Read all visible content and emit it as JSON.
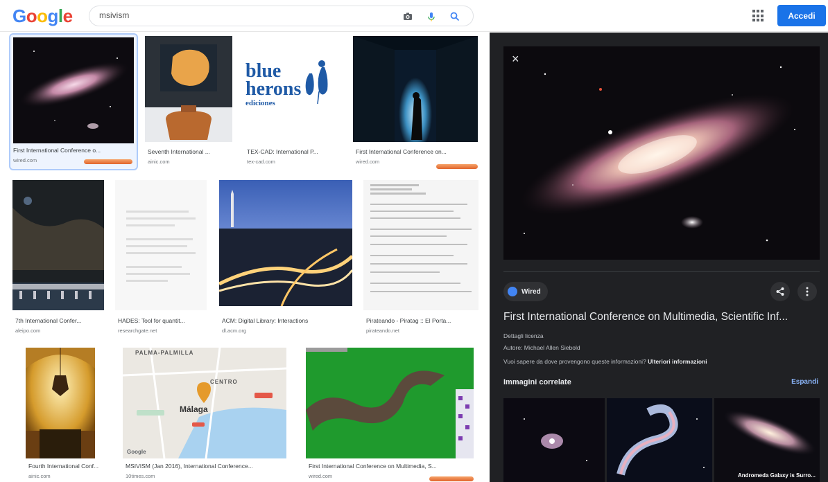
{
  "header": {
    "logo": [
      "G",
      "o",
      "o",
      "g",
      "l",
      "e"
    ],
    "search_value": "msivism",
    "login_label": "Accedi",
    "icons": [
      "camera-icon",
      "mic-icon",
      "search-icon",
      "apps-icon"
    ]
  },
  "results": [
    {
      "caption": "First International Conference o...",
      "source": "wired.com"
    },
    {
      "caption": "Seventh International ...",
      "source": "ainic.com"
    },
    {
      "caption": "TEX-CAD: International P...",
      "source": "tex-cad.com"
    },
    {
      "caption": "First International Conference on...",
      "source": "wired.com"
    },
    {
      "caption": "7th International Confer...",
      "source": "aleipo.com"
    },
    {
      "caption": "HADES: Tool for quantit...",
      "source": "researchgate.net"
    },
    {
      "caption": "ACM: Digital Library: Interactions",
      "source": "dl.acm.org"
    },
    {
      "caption": "Pirateando - Piratag :: El Porta...",
      "source": "pirateando.net"
    },
    {
      "caption": "Fourth International Conf...",
      "source": "ainic.com"
    },
    {
      "caption": "MSIVISM (Jan 2016), International Conference...",
      "source": "10times.com"
    },
    {
      "caption": "First International Conference on Multimedia, S...",
      "source": "wired.com"
    }
  ],
  "thumb_text": {
    "blue_herons": [
      "blue",
      "herons",
      "ediciones"
    ],
    "map_labels": [
      "PALMA-PALMILLA",
      "CENTRO",
      "Málaga",
      "Google"
    ]
  },
  "panel": {
    "close": "×",
    "source_name": "Wired",
    "title": "First International Conference on Multimedia, Scientific Inf...",
    "license": "Dettagli licenza",
    "author": "Autore: Michael Allen Siebold",
    "info_question": "Vuoi sapere da dove provengono queste informazioni?",
    "info_link": "Ulteriori informazioni",
    "related_title": "Immagini correlate",
    "expand_label": "Espandi",
    "related_caption": "Andromeda Galaxy is Surro..."
  }
}
